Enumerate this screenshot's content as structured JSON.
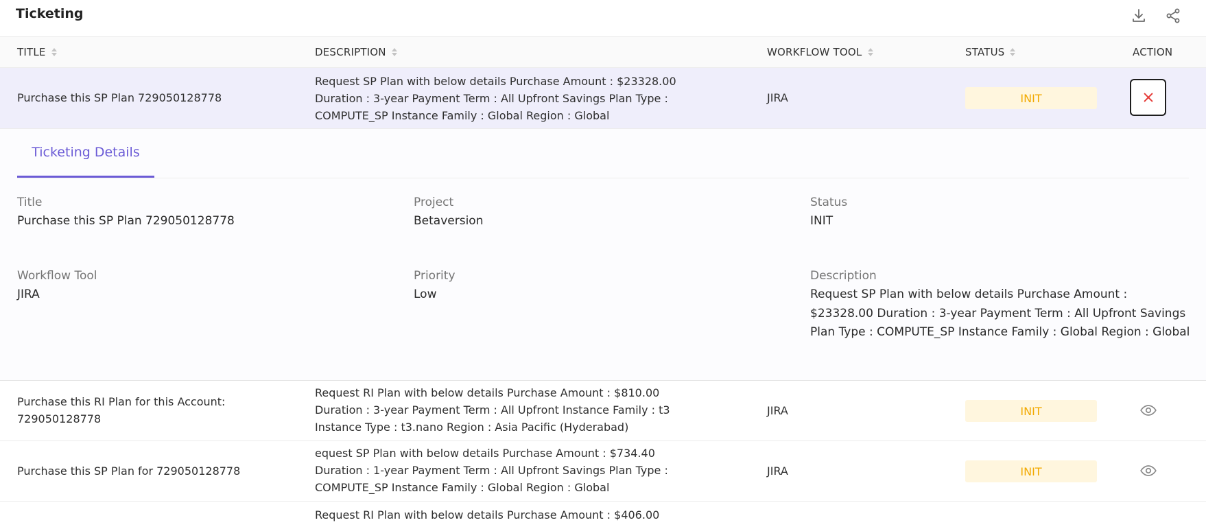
{
  "header": {
    "title": "Ticketing",
    "download_icon": "download-icon",
    "share_icon": "share-icon"
  },
  "table": {
    "columns": [
      "TITLE",
      "DESCRIPTION",
      "WORKFLOW TOOL",
      "STATUS",
      "ACTION"
    ],
    "rows": [
      {
        "title": "Purchase this SP Plan 729050128778",
        "description": "Request SP Plan with below details Purchase Amount : $23328.00 Duration : 3-year Payment Term : All Upfront Savings Plan Type : COMPUTE_SP Instance Family : Global Region : Global",
        "tool": "JIRA",
        "status": "INIT",
        "action_icon": "close-icon"
      },
      {
        "title": "Purchase this RI Plan for this Account: 729050128778",
        "description": "Request RI Plan with below details Purchase Amount : $810.00 Duration : 3-year Payment Term : All Upfront Instance Family : t3 Instance Type : t3.nano Region : Asia Pacific (Hyderabad)",
        "tool": "JIRA",
        "status": "INIT",
        "action_icon": "eye-icon"
      },
      {
        "title": "Purchase this SP Plan for 729050128778",
        "description": "equest SP Plan with below details Purchase Amount : $734.40 Duration : 1-year Payment Term : All Upfront Savings Plan Type : COMPUTE_SP Instance Family : Global Region : Global",
        "tool": "JIRA",
        "status": "INIT",
        "action_icon": "eye-icon"
      },
      {
        "description": "Request RI Plan with below details Purchase Amount : $406.00"
      }
    ]
  },
  "details": {
    "tab_label": "Ticketing Details",
    "fields": {
      "title": {
        "label": "Title",
        "value": "Purchase this SP Plan 729050128778"
      },
      "project": {
        "label": "Project",
        "value": "Betaversion"
      },
      "status": {
        "label": "Status",
        "value": "INIT"
      },
      "workflow_tool": {
        "label": "Workflow Tool",
        "value": "JIRA"
      },
      "priority": {
        "label": "Priority",
        "value": "Low"
      },
      "description": {
        "label": "Description",
        "value": "Request SP Plan with below details Purchase Amount : $23328.00 Duration : 3-year Payment Term : All Upfront Savings Plan Type : COMPUTE_SP Instance Family : Global Region : Global"
      }
    }
  },
  "colors": {
    "accent": "#6b5bd6",
    "status_text": "#f2a900",
    "status_bg": "#fff6de",
    "selected_row_bg": "#efeefb",
    "close_icon": "#e53935"
  }
}
